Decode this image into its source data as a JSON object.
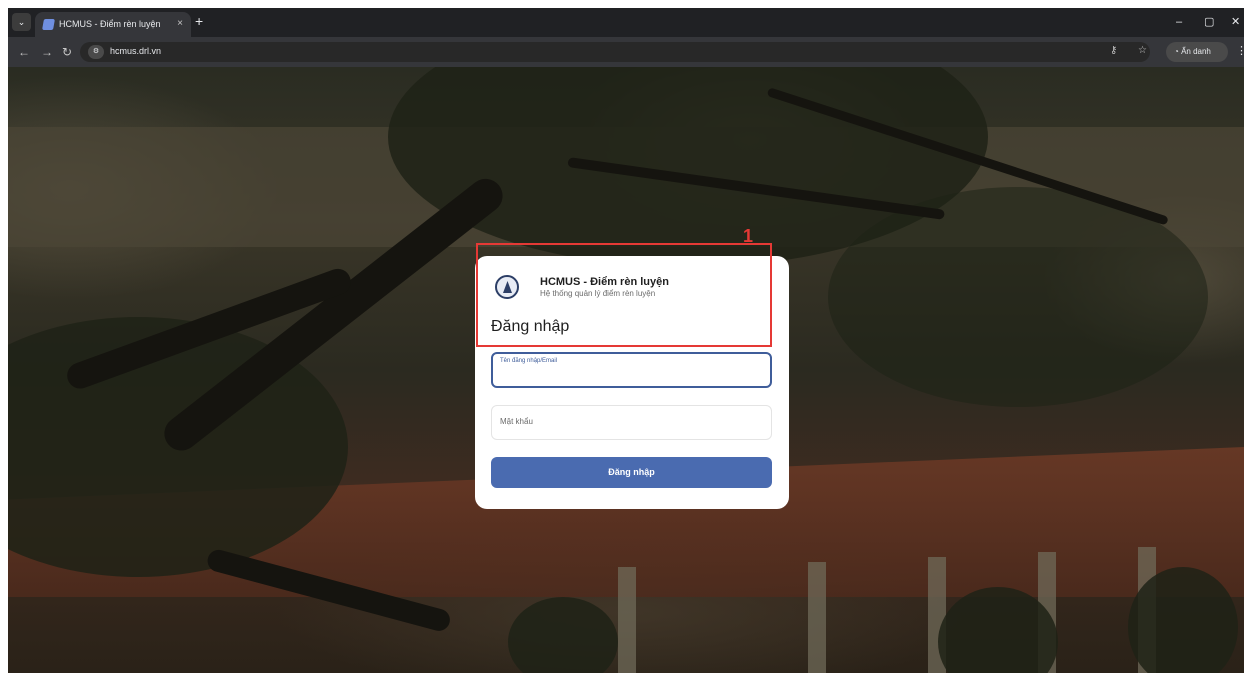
{
  "browser": {
    "tab_title": "HCMUS - Điểm rèn luyện",
    "tab_close": "×",
    "new_tab": "+",
    "url": "hcmus.drl.vn",
    "incognito_label": "Ẩn danh",
    "icons": {
      "tab_search": "chevron-down-icon",
      "back": "back-arrow-icon",
      "forward": "forward-arrow-icon",
      "reload": "reload-icon",
      "site_info": "site-info-icon",
      "password_key": "key-icon",
      "bookmark": "star-icon",
      "incognito": "incognito-icon",
      "menu": "menu-dots-icon",
      "minimize": "minimize-icon",
      "restore": "restore-icon",
      "close": "close-icon"
    }
  },
  "login_card": {
    "app_title": "HCMUS - Điểm rèn luyện",
    "app_subtitle": "Hệ thống quản lý điểm rèn luyện",
    "heading": "Đăng nhập",
    "username_label": "Tên đăng nhập/Email",
    "username_value": "",
    "password_placeholder": "Mật khẩu",
    "password_value": "",
    "submit_label": "Đăng nhập"
  },
  "annotation": {
    "number": "1",
    "color": "#e53935"
  },
  "colors": {
    "primary": "#4a6bb0",
    "focus_border": "#3f5d9a",
    "browser_dark": "#202124"
  }
}
